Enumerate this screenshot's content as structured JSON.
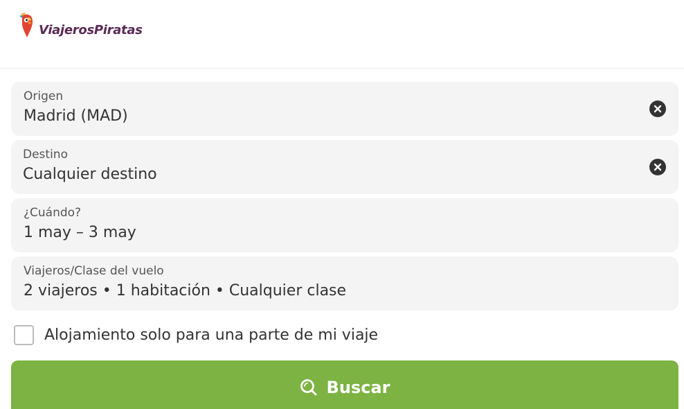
{
  "header": {
    "logo_text": "ViajerosPiratas"
  },
  "form": {
    "origin": {
      "label": "Origen",
      "value": "Madrid (MAD)"
    },
    "destination": {
      "label": "Destino",
      "value": "Cualquier destino"
    },
    "dates": {
      "label": "¿Cuándo?",
      "value": "1 may – 3 may"
    },
    "travelers": {
      "label": "Viajeros/Clase del vuelo",
      "value": "2 viajeros • 1 habitación • Cualquier clase"
    },
    "partial_stay": {
      "label": "Alojamiento solo para una parte de mi viaje",
      "checked": false
    },
    "search_button": {
      "label": "Buscar"
    }
  },
  "icons": {
    "logo": "parrot-logo-icon",
    "clear": "close-circle-icon",
    "search": "search-icon"
  },
  "colors": {
    "brand": "#5b2a57",
    "button": "#7cb342",
    "field_bg": "#f4f4f4"
  }
}
